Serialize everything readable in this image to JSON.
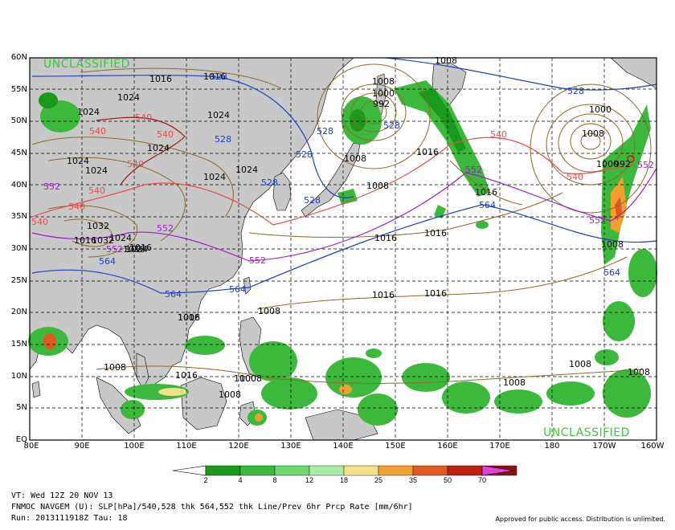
{
  "map": {
    "classification_top": "UNCLASSIFIED",
    "classification_bottom": "UNCLASSIFIED",
    "lat_labels": [
      "60N",
      "55N",
      "50N",
      "45N",
      "40N",
      "35N",
      "30N",
      "25N",
      "20N",
      "15N",
      "10N",
      "5N",
      "EQ"
    ],
    "lon_labels": [
      "80E",
      "90E",
      "100E",
      "110E",
      "120E",
      "130E",
      "140E",
      "150E",
      "160E",
      "170E",
      "180",
      "170W",
      "160W"
    ],
    "colors": {
      "land": "#c8c8c8",
      "slp_contour": "#8b6a2e",
      "thk_540": "#e05050",
      "thk_552": "#a020c0",
      "thk_528_564": "#2040c0",
      "precip_label": "#3cc83c"
    },
    "slp_labels": [
      "1016",
      "1016",
      "1024",
      "1024",
      "1024",
      "1024",
      "1024",
      "1024",
      "1024",
      "1024",
      "1032",
      "1032",
      "1024",
      "1016",
      "1008",
      "1000",
      "992",
      "1008",
      "1008",
      "1000",
      "1008",
      "1016",
      "1016",
      "1016",
      "1016",
      "1016",
      "1016",
      "1008",
      "1008",
      "1008",
      "1008",
      "1008",
      "1016",
      "1008",
      "1000",
      "992",
      "1008",
      "1008",
      "1000",
      "1008",
      "1024",
      "1016",
      "1016",
      "1016",
      "1008"
    ],
    "thk_labels": [
      "528",
      "528",
      "528",
      "528",
      "528",
      "528",
      "528",
      "540",
      "540",
      "540",
      "540",
      "540",
      "540",
      "540",
      "540",
      "552",
      "552",
      "552",
      "552",
      "552",
      "552",
      "564",
      "564",
      "564",
      "564",
      "528",
      "540",
      "552",
      "564"
    ]
  },
  "colorbar": {
    "values": [
      "2",
      "4",
      "8",
      "12",
      "18",
      "25",
      "35",
      "50",
      "70"
    ],
    "colors": [
      "#1a9a1a",
      "#3cb93c",
      "#6ed86e",
      "#a8eea8",
      "#f5e08a",
      "#f0a030",
      "#e05a20",
      "#c02010",
      "#901010",
      "#e040e0"
    ]
  },
  "footer": {
    "vt": "VT: Wed 12Z 20 NOV 13",
    "title": "FNMOC NAVGEM (U): SLP[hPa]/540,528 thk 564,552 thk Line/Prev 6hr Prcp Rate [mm/6hr]",
    "run": "Run: 2013111918Z Tau: 18",
    "approval": "Approved for public access. Distribution is unlimited."
  }
}
